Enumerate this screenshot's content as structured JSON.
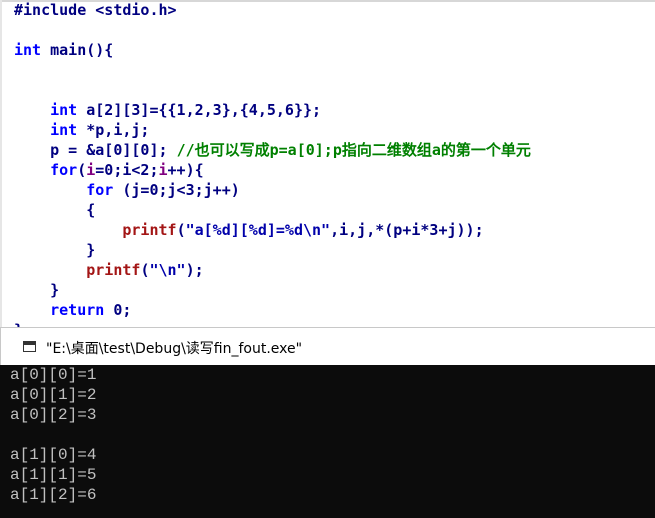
{
  "editor": {
    "lines": [
      [
        {
          "t": "#include <stdio.h>",
          "c": "id"
        }
      ],
      [
        {
          "t": "",
          "c": "id"
        }
      ],
      [
        {
          "t": "int",
          "c": "kw"
        },
        {
          "t": " main(){",
          "c": "id"
        }
      ],
      [
        {
          "t": "",
          "c": "id"
        }
      ],
      [
        {
          "t": "",
          "c": "id"
        }
      ],
      [
        {
          "t": "    ",
          "c": "id"
        },
        {
          "t": "int",
          "c": "kw"
        },
        {
          "t": " a[2][3]={{1,2,3},{4,5,6}};",
          "c": "id"
        }
      ],
      [
        {
          "t": "    ",
          "c": "id"
        },
        {
          "t": "int",
          "c": "kw"
        },
        {
          "t": " *p,i,j;",
          "c": "id"
        }
      ],
      [
        {
          "t": "    p = &a[0][0]; ",
          "c": "id"
        },
        {
          "t": "//也可以写成p=a[0];p指向二维数组a的第一个单元",
          "c": "cm"
        }
      ],
      [
        {
          "t": "    ",
          "c": "id"
        },
        {
          "t": "for",
          "c": "kw"
        },
        {
          "t": "(",
          "c": "id"
        },
        {
          "t": "i",
          "c": "hl"
        },
        {
          "t": "=0;i<2;",
          "c": "id"
        },
        {
          "t": "i",
          "c": "hl"
        },
        {
          "t": "++){",
          "c": "id"
        }
      ],
      [
        {
          "t": "        ",
          "c": "id"
        },
        {
          "t": "for",
          "c": "kw"
        },
        {
          "t": " (j=0;j<3;j++)",
          "c": "id"
        }
      ],
      [
        {
          "t": "        {",
          "c": "id"
        }
      ],
      [
        {
          "t": "            ",
          "c": "id"
        },
        {
          "t": "printf",
          "c": "fn"
        },
        {
          "t": "(",
          "c": "id"
        },
        {
          "t": "\"a[%d][%d]=%d\\n\"",
          "c": "str"
        },
        {
          "t": ",i,j,*(p+i*3+j));",
          "c": "id"
        }
      ],
      [
        {
          "t": "        }",
          "c": "id"
        }
      ],
      [
        {
          "t": "        ",
          "c": "id"
        },
        {
          "t": "printf",
          "c": "fn"
        },
        {
          "t": "(",
          "c": "id"
        },
        {
          "t": "\"\\n\"",
          "c": "str"
        },
        {
          "t": ");",
          "c": "id"
        }
      ],
      [
        {
          "t": "    }",
          "c": "id"
        }
      ],
      [
        {
          "t": "    ",
          "c": "id"
        },
        {
          "t": "return",
          "c": "kw"
        },
        {
          "t": " 0;",
          "c": "id"
        }
      ],
      [
        {
          "t": "}",
          "c": "id"
        }
      ]
    ]
  },
  "console_window": {
    "title": "\"E:\\桌面\\test\\Debug\\读写fin_fout.exe\"",
    "output": [
      "a[0][0]=1",
      "a[0][1]=2",
      "a[0][2]=3",
      "",
      "a[1][0]=4",
      "a[1][1]=5",
      "a[1][2]=6"
    ]
  }
}
